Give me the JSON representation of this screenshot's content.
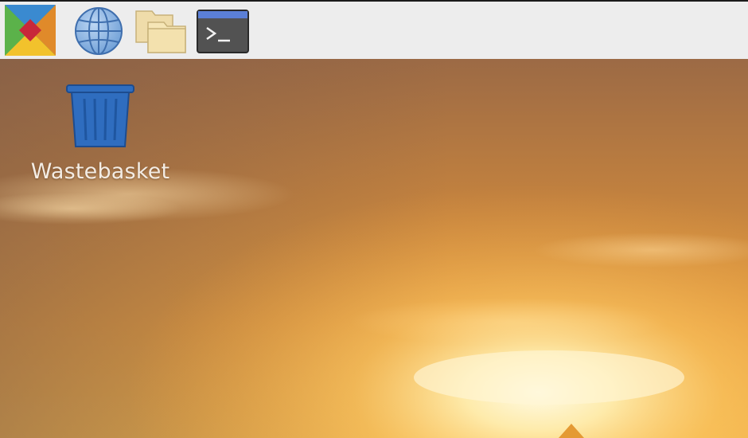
{
  "taskbar": {
    "items": [
      {
        "name": "menu",
        "icon": "raspberry-menu-icon"
      },
      {
        "name": "web-browser",
        "icon": "globe-icon"
      },
      {
        "name": "file-manager",
        "icon": "folder-icon"
      },
      {
        "name": "terminal",
        "icon": "terminal-icon",
        "glyph": ">_"
      }
    ]
  },
  "desktop": {
    "icons": [
      {
        "label": "Wastebasket",
        "icon": "wastebasket-icon"
      }
    ]
  },
  "colors": {
    "taskbar_bg": "#ededed",
    "wallpaper_sky": "#b9773f",
    "wallpaper_glow": "#ffe7a3",
    "wastebasket_blue": "#2f6dbf"
  }
}
